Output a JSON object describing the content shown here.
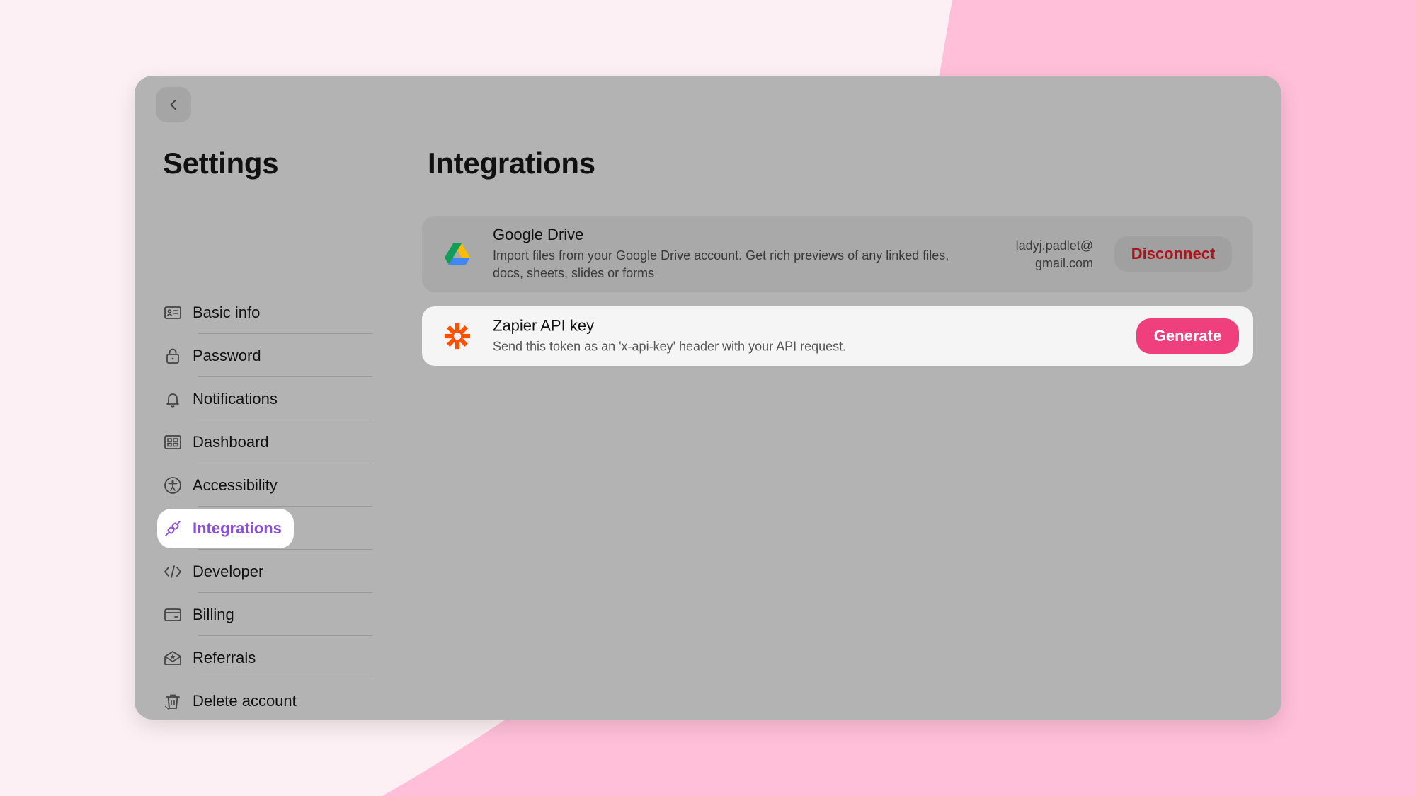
{
  "colors": {
    "background": "#fdf0f4",
    "background_shape": "#ffbfd8",
    "window": "#b3b3b3",
    "active_accent": "#8a4fd6",
    "disconnect_text": "#b0121b",
    "generate_button": "#ef3f7d",
    "zapier_orange": "#ff4f00"
  },
  "window": {
    "back_icon": "chevron-left-icon"
  },
  "sidebar": {
    "title": "Settings",
    "active_item": "integrations",
    "items": [
      {
        "id": "basic-info",
        "label": "Basic info",
        "icon": "id-card-icon"
      },
      {
        "id": "password",
        "label": "Password",
        "icon": "lock-icon"
      },
      {
        "id": "notifications",
        "label": "Notifications",
        "icon": "bell-icon"
      },
      {
        "id": "dashboard",
        "label": "Dashboard",
        "icon": "dashboard-icon"
      },
      {
        "id": "accessibility",
        "label": "Accessibility",
        "icon": "accessibility-icon"
      },
      {
        "id": "integrations",
        "label": "Integrations",
        "icon": "plug-icon"
      },
      {
        "id": "developer",
        "label": "Developer",
        "icon": "code-icon"
      },
      {
        "id": "billing",
        "label": "Billing",
        "icon": "credit-card-icon"
      },
      {
        "id": "referrals",
        "label": "Referrals",
        "icon": "referral-envelope-icon"
      },
      {
        "id": "delete-account",
        "label": "Delete account",
        "icon": "trash-icon"
      }
    ]
  },
  "main": {
    "title": "Integrations",
    "integrations": [
      {
        "name": "Google Drive",
        "description": "Import files from your Google Drive account. Get rich previews of any linked files, docs, sheets, slides or forms",
        "account_line1": "ladyj.padlet@",
        "account_line2": "gmail.com",
        "action_label": "Disconnect",
        "icon": "google-drive-icon"
      },
      {
        "name": "Zapier API key",
        "description": "Send this token as an 'x-api-key' header with your API request.",
        "action_label": "Generate",
        "icon": "zapier-icon"
      }
    ]
  }
}
